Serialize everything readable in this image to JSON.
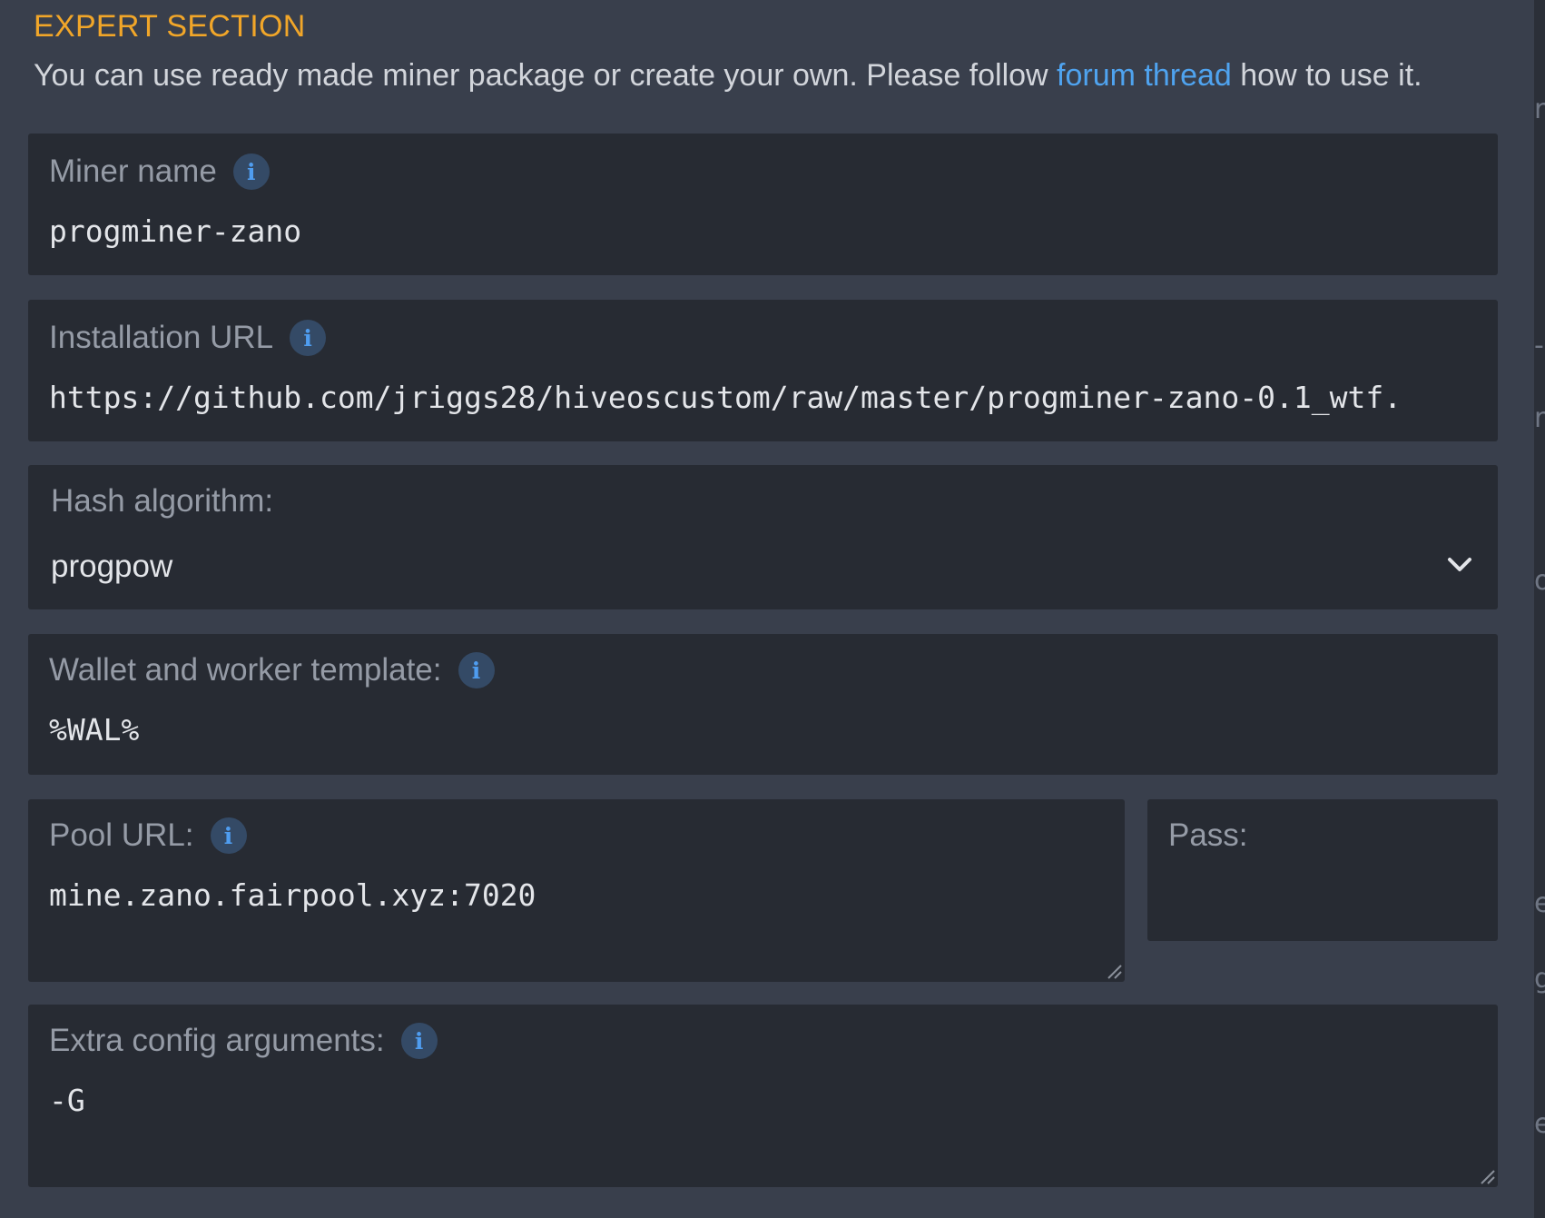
{
  "section": {
    "title": "EXPERT SECTION",
    "description_before": "You can use ready made miner package or create your own. Please follow ",
    "link_text": "forum thread",
    "description_after": " how to use it."
  },
  "fields": {
    "miner_name": {
      "label": "Miner name",
      "value": "progminer-zano"
    },
    "installation_url": {
      "label": "Installation URL",
      "value": "https://github.com/jriggs28/hiveoscustom/raw/master/progminer-zano-0.1_wtf."
    },
    "hash_algorithm": {
      "label": "Hash algorithm:",
      "value": "progpow"
    },
    "wallet_template": {
      "label": "Wallet and worker template:",
      "value": "%WAL%"
    },
    "pool_url": {
      "label": "Pool URL:",
      "value": "mine.zano.fairpool.xyz:7020"
    },
    "pass": {
      "label": "Pass:",
      "value": ""
    },
    "extra_config": {
      "label": "Extra config arguments:",
      "value": "-G"
    }
  },
  "info_icon_glyph": "i",
  "right_edge_chars": [
    "r",
    "-",
    "r",
    "o",
    "e",
    "g",
    "e"
  ],
  "icons": {
    "info": "info-icon",
    "dropdown": "chevron-down-icon",
    "resize": "resize-grip-icon"
  },
  "colors": {
    "background": "#393f4c",
    "field_background": "#272b33",
    "title_accent": "#f1a629",
    "link": "#4fa3ef",
    "label": "#959ba6",
    "value": "#e3e5e9"
  }
}
